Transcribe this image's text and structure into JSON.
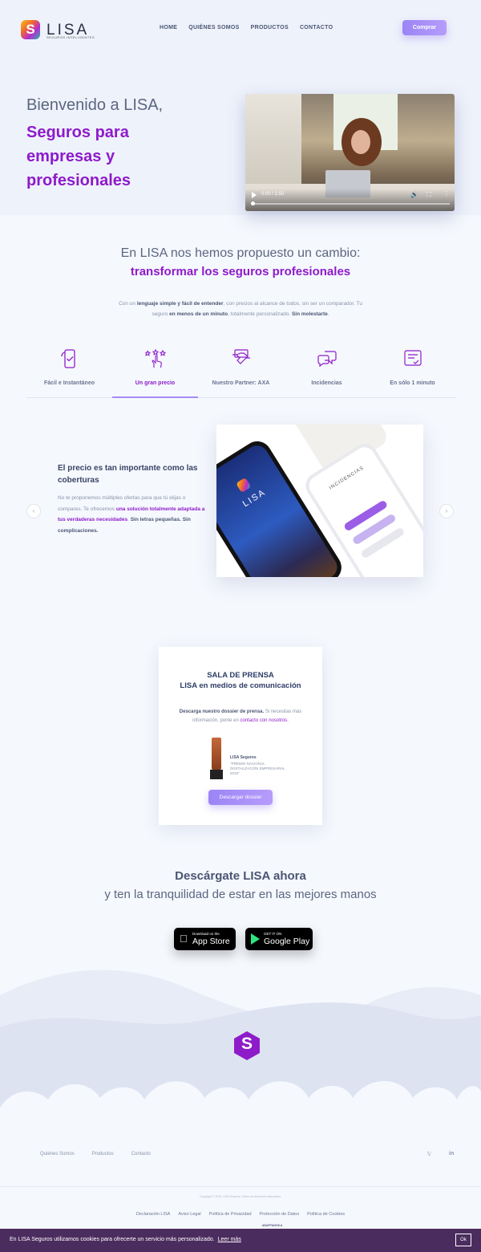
{
  "brand": {
    "name": "LISA",
    "tagline": "SEGUROS INTELIGENTES",
    "logo_letter": "S"
  },
  "nav": {
    "items": [
      "HOME",
      "QUIÉNES SOMOS",
      "PRODUCTOS",
      "CONTACTO"
    ],
    "buy_label": "Comprar"
  },
  "hero": {
    "line1": "Bienvenido a LISA,",
    "line2": "Seguros para empresas y profesionales",
    "video_time": "0:00 / 1:50"
  },
  "intro": {
    "line1": "En LISA nos hemos propuesto un cambio:",
    "line2": "transformar los seguros profesionales",
    "p1": "Con un ",
    "p1b": "lenguaje simple y fácil de entender",
    "p2": ", con precios al alcance de todos, sin ser un comparador. Tu seguro ",
    "p2b": "en menos de un minuto",
    "p3": ", totalmente personalizado. ",
    "p3b": "Sin molestarte",
    "p4": "."
  },
  "tabs": [
    {
      "label": "Fácil e Instantáneo",
      "icon": "phone-check-icon"
    },
    {
      "label": "Un gran precio",
      "icon": "stars-hand-icon"
    },
    {
      "label": "Nuestro Partner: AXA",
      "icon": "handshake-icon"
    },
    {
      "label": "Incidencias",
      "icon": "chat-bubbles-icon"
    },
    {
      "label": "En sólo 1 minuto",
      "icon": "document-check-icon"
    }
  ],
  "active_tab_index": 1,
  "slide": {
    "title": "El precio es tan importante como las coberturas",
    "p1": "No te proponemos múltiples ofertas para que tú elijas o compares. Te ofrecemos ",
    "p1b": "una solución totalmente adaptada a tus verdaderas necesidades",
    "p2": ". ",
    "p2b": "Sin letras pequeñas. Sin complicaciones.",
    "phone_brand": "LISA",
    "phone_screen": "INCIDENCIAS"
  },
  "press": {
    "title1": "SALA DE PRENSA",
    "title2": "LISA en medios de comunicación",
    "p1b": "Descarga nuestro dossier de prensa.",
    "p1": " Si necesitas más información, ponte en ",
    "p1link": "contacto con nosotros",
    "p2": ".",
    "award_title": "LISA Seguros",
    "award_sub": "\"PREMIO NACIONAL DIGITALIZACIÓN EMPRESARIAL 2018\"",
    "button": "Descargar dossier"
  },
  "download": {
    "title": "Descárgate LISA ahora",
    "subtitle": "y ten la tranquilidad de estar en las mejores manos",
    "appstore_small": "Download on the",
    "appstore_big": "App Store",
    "gplay_small": "GET IT ON",
    "gplay_big": "Google Play"
  },
  "footer": {
    "nav": [
      "Quiénes Somos",
      "Productos",
      "Contacto"
    ],
    "copyright": "Copyright © 2019. LISA Seguros. Todos los derechos reservados.",
    "legal": [
      "Declaración LISA",
      "Aviso Legal",
      "Política de Privacidad",
      "Protección de Datos",
      "Política de Cookies"
    ],
    "adapt_label": "ADAPTADOS A"
  },
  "cookie": {
    "text": "En LISA Seguros utilizamos cookies para ofrecerte un servicio más personalizado.",
    "link": "Leer más",
    "ok": "Ok"
  },
  "colors": {
    "accent": "#8e1bc9",
    "button": "#a68af7",
    "cookie_bg": "#4b2c5e"
  }
}
